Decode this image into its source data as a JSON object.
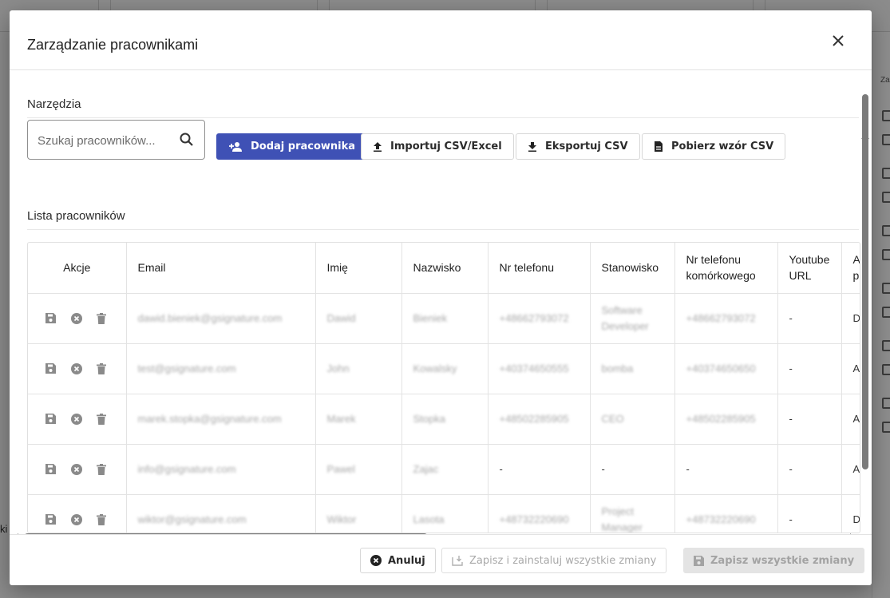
{
  "background": {
    "right_col_header": "Za",
    "left_label": "ki"
  },
  "dialog": {
    "title": "Zarządzanie pracownikami",
    "tools_section": "Narzędzia",
    "search": {
      "placeholder": "Szukaj pracowników..."
    },
    "buttons": {
      "add": "Dodaj pracownika",
      "import": "Importuj CSV/Excel",
      "export": "Eksportuj CSV",
      "template": "Pobierz wzór CSV"
    },
    "list_section": "Lista pracowników",
    "table": {
      "headers": [
        "Akcje",
        "Email",
        "Imię",
        "Nazwisko",
        "Nr telefonu",
        "Stanowisko",
        "Nr telefonu komórkowego",
        "Youtube URL",
        "A pr"
      ],
      "rows": [
        {
          "email": "dawid.bieniek@gsignature.com",
          "first": "Dawid",
          "last": "Bieniek",
          "phone": "+48662793072",
          "position": "Software Developer",
          "mobile": "+48662793072",
          "youtube": "-",
          "extra": "D ac"
        },
        {
          "email": "test@gsignature.com",
          "first": "John",
          "last": "Kowalsky",
          "phone": "+40374650555",
          "position": "bomba",
          "mobile": "+40374650650",
          "youtube": "-",
          "extra": "A W"
        },
        {
          "email": "marek.stopka@gsignature.com",
          "first": "Marek",
          "last": "Stopka",
          "phone": "+48502285905",
          "position": "CEO",
          "mobile": "+48502285905",
          "youtube": "-",
          "extra": "A lo"
        },
        {
          "email": "info@gsignature.com",
          "first": "Pawel",
          "last": "Zajac",
          "phone": "-",
          "position": "-",
          "mobile": "-",
          "youtube": "-",
          "extra": "A W"
        },
        {
          "email": "wiktor@gsignature.com",
          "first": "Wiktor",
          "last": "Lasota",
          "phone": "+48732220690",
          "position": "Project Manager",
          "mobile": "+48732220690",
          "youtube": "-",
          "extra": "D ac"
        }
      ]
    },
    "footer": {
      "cancel": "Anuluj",
      "save_install": "Zapisz i zainstaluj wszystkie zmiany",
      "save_all": "Zapisz wszystkie zmiany"
    }
  },
  "colors": {
    "primary": "#3f51b5",
    "overlay": "#8a8a8a",
    "icon_gray": "#8a8a8a"
  }
}
